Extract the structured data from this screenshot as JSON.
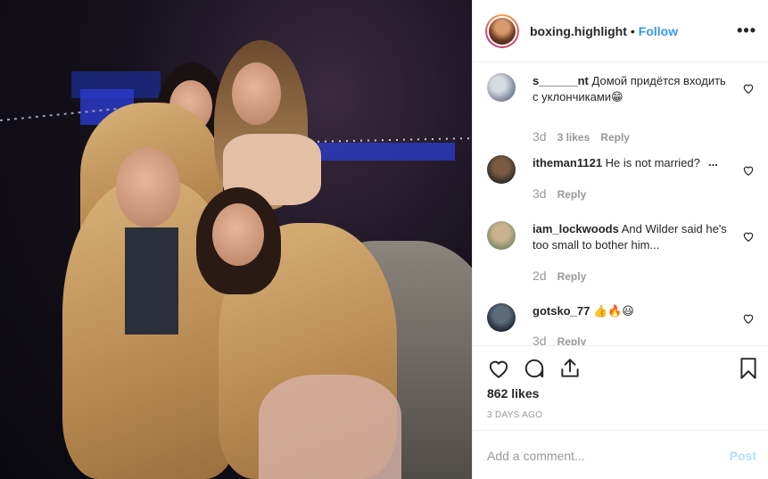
{
  "header": {
    "username": "boxing.highlight",
    "separator": "•",
    "follow_label": "Follow",
    "more_label": "•••"
  },
  "comments": [
    {
      "username": "s______nt",
      "text": "Домой придётся входить с уклончиками😁",
      "time": "3d",
      "likes": "3 likes",
      "reply": "Reply"
    },
    {
      "username": "itheman1121",
      "text": "He is not married?",
      "time": "3d",
      "likes": "",
      "reply": "Reply"
    },
    {
      "username": "iam_lockwoods",
      "text": "And Wilder said he's too small to bother him...",
      "time": "2d",
      "likes": "",
      "reply": "Reply"
    },
    {
      "username": "gotsko_77",
      "text": "👍🔥😃",
      "time": "3d",
      "likes": "",
      "reply": "Reply"
    }
  ],
  "inline_more": "...",
  "post": {
    "likes": "862 likes",
    "time_ago": "3 DAYS AGO"
  },
  "add_comment": {
    "placeholder": "Add a comment...",
    "post_label": "Post"
  },
  "icons": {
    "like": "heart-icon",
    "comment": "comment-icon",
    "share": "share-icon",
    "save": "bookmark-icon",
    "more": "more-options-icon"
  },
  "colors": {
    "accent": "#3897f0",
    "text": "#262626",
    "muted": "#999999",
    "post_disabled": "#b2dffc",
    "border": "#efefef"
  }
}
